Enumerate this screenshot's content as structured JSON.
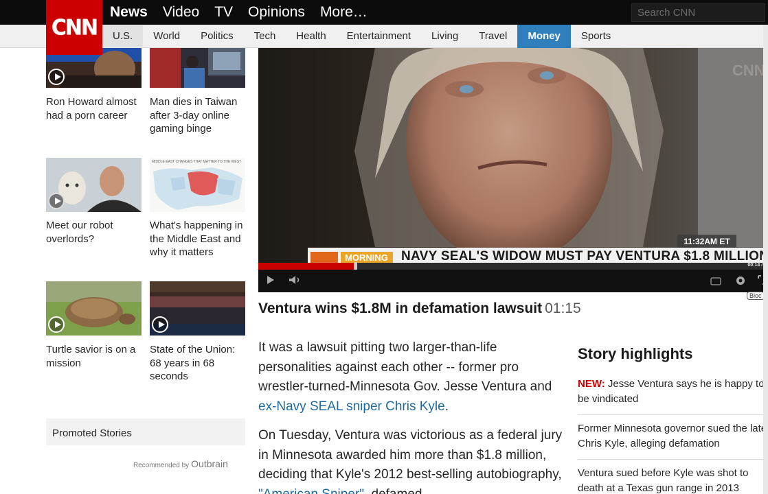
{
  "brand": {
    "logo_text": "CNN"
  },
  "main_nav": [
    "News",
    "Video",
    "TV",
    "Opinions",
    "More…"
  ],
  "search": {
    "placeholder": "Search CNN"
  },
  "sub_nav": [
    "U.S.",
    "World",
    "Politics",
    "Tech",
    "Health",
    "Entertainment",
    "Living",
    "Travel",
    "Money",
    "Sports"
  ],
  "rail": {
    "items": [
      {
        "caption": "Ron Howard almost had a porn career"
      },
      {
        "caption": "Man dies in Taiwan after 3-day online gaming binge"
      },
      {
        "caption": "Meet our robot overlords?"
      },
      {
        "caption": "What's happening in the Middle East and why it matters"
      },
      {
        "caption": "Turtle savior is on a mission"
      },
      {
        "caption": "State of the Union: 68 years in 68 seconds"
      }
    ],
    "map_header": "MIDDLE EAST CHANGES THAT MATTER TO THE WEST",
    "promoted": "Promoted Stories",
    "recommended_by": "Recommended by",
    "outbrain": "Outbrain"
  },
  "video": {
    "show_label": "MORNING",
    "chyron": "NAVY SEAL'S WIDOW MUST PAY VENTURA $1.8 MILLION",
    "time_bug": "11:32AM ET",
    "elapsed": "00:14 / 0",
    "progress_fraction": 0.19,
    "block_label": "Bloc",
    "watermark": "CNN"
  },
  "article": {
    "title": "Ventura wins $1.8M in defamation lawsuit",
    "duration": "01:15",
    "p1_text": "It was a lawsuit pitting two larger-than-life personalities against each other -- former pro wrestler-turned-Minnesota Gov. Jesse Ventura and ",
    "p1_link": "ex-Navy SEAL sniper Chris Kyle",
    "p1_end": ".",
    "p2_text": "On Tuesday, Ventura was victorious as a federal jury in Minnesota awarded him more than $1.8 million, deciding that Kyle's 2012 best-selling autobiography, ",
    "p2_link": "\"American Sniper\"",
    "p2_end": ", defamed"
  },
  "highlights": {
    "title": "Story highlights",
    "new_label": "NEW:",
    "items": [
      "Jesse Ventura says he is happy to be vindicated",
      "Former Minnesota governor sued the late Chris Kyle, alleging defamation",
      "Ventura sued before Kyle was shot to death at a Texas gun range in 2013"
    ]
  },
  "colors": {
    "brand_red": "#cc0000",
    "active_tab": "#2f7fbc",
    "link": "#1e6a9e",
    "new_red": "#cc0000"
  }
}
